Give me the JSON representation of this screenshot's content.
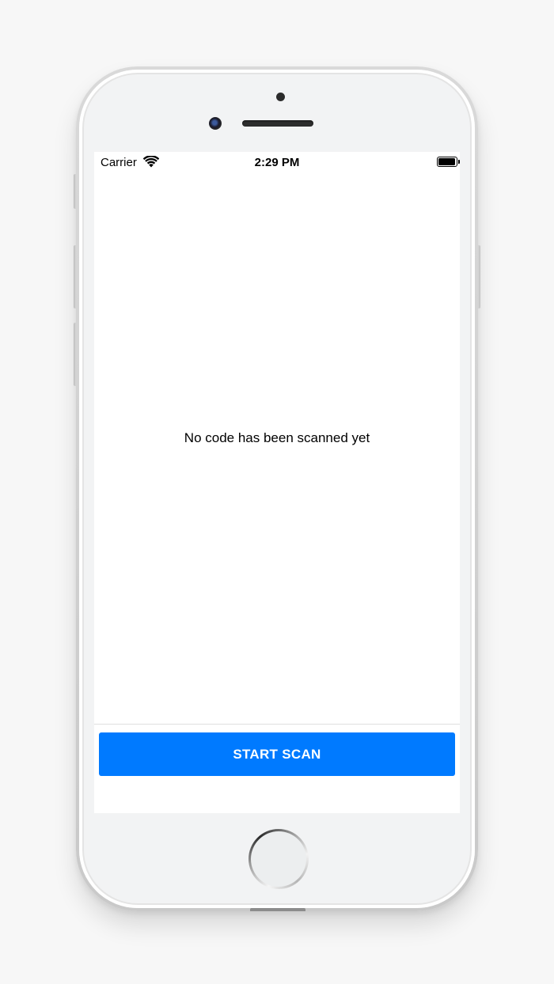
{
  "status_bar": {
    "carrier": "Carrier",
    "time": "2:29 PM",
    "wifi_icon": "wifi-icon",
    "battery_icon": "battery-icon"
  },
  "main": {
    "message": "No code has been scanned yet"
  },
  "footer": {
    "scan_button_label": "START SCAN"
  },
  "colors": {
    "accent": "#007aff",
    "background": "#ffffff",
    "text": "#000000"
  }
}
